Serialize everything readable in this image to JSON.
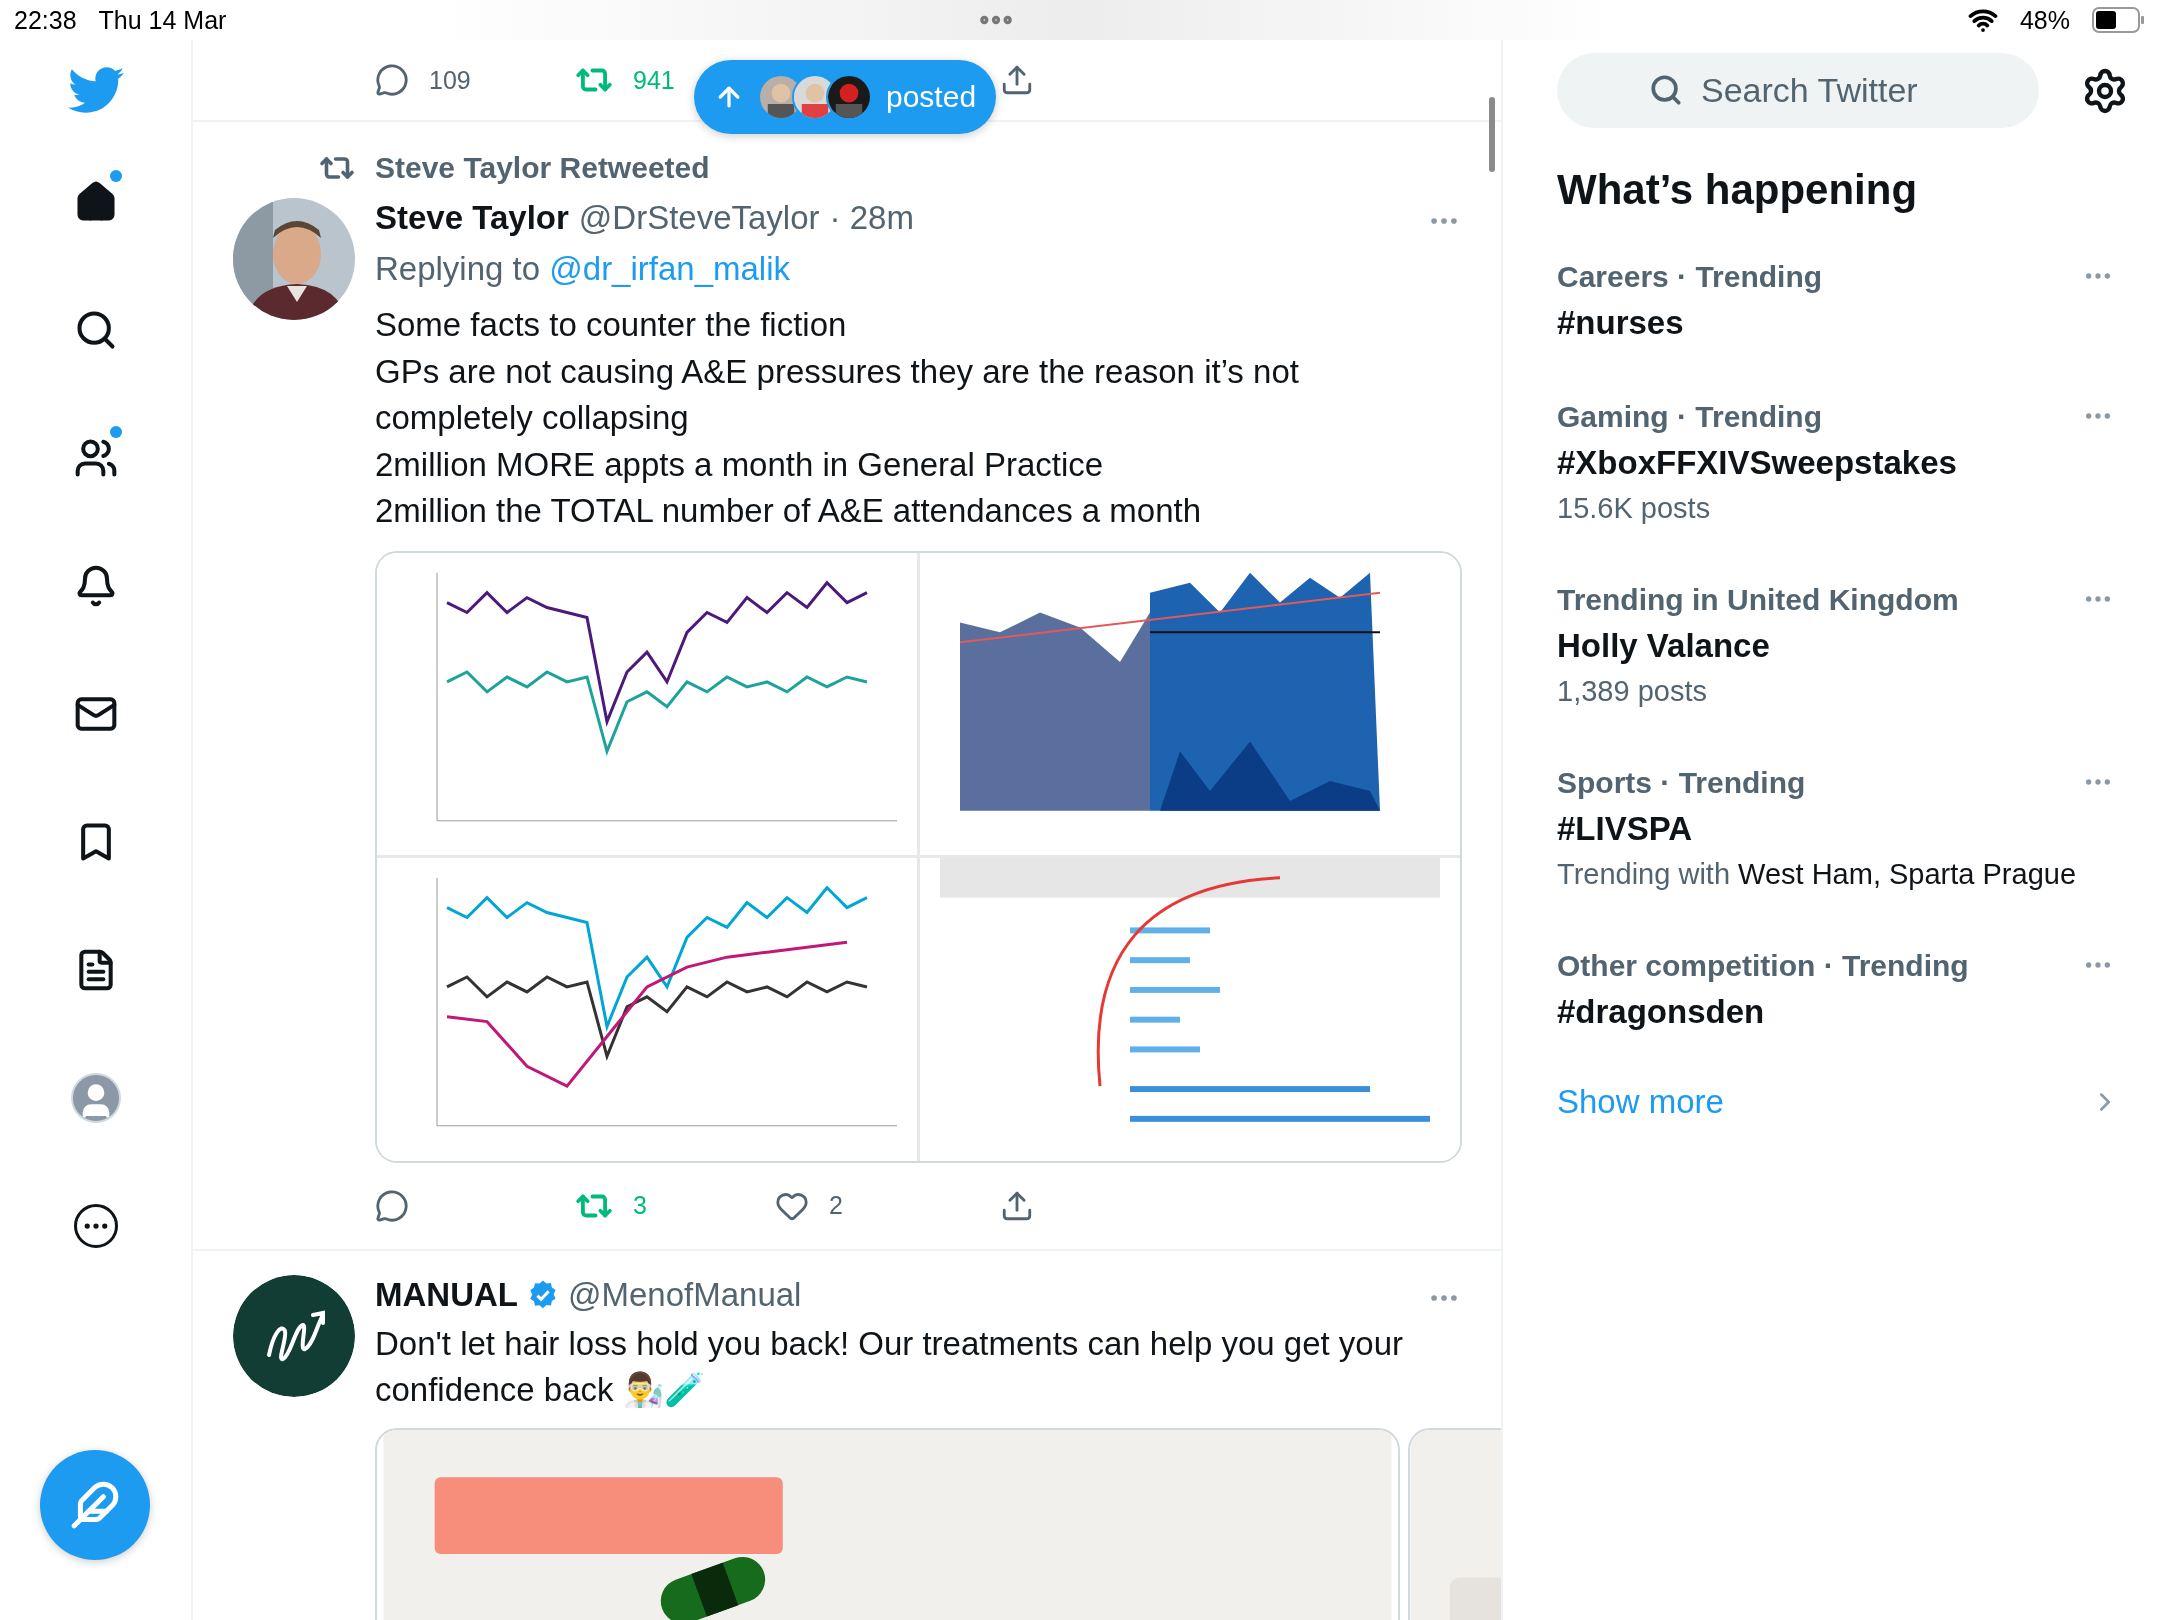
{
  "status_bar": {
    "time": "22:38",
    "date": "Thu 14 Mar",
    "battery": "48%"
  },
  "nav": [
    {
      "kind": "logo",
      "dot": false
    },
    {
      "kind": "home",
      "dot": true
    },
    {
      "kind": "search",
      "dot": false
    },
    {
      "kind": "people",
      "dot": true
    },
    {
      "kind": "bell",
      "dot": false
    },
    {
      "kind": "mail",
      "dot": false
    },
    {
      "kind": "bookmark",
      "dot": false
    },
    {
      "kind": "list",
      "dot": false
    },
    {
      "kind": "avatar",
      "dot": false
    },
    {
      "kind": "more",
      "dot": false
    }
  ],
  "previous_tweet_actions": {
    "replies": "109",
    "retweets": "941",
    "retweeted": true
  },
  "posted_pill": {
    "label": "posted"
  },
  "tweets": [
    {
      "retweeted_by": "Steve Taylor Retweeted",
      "name": "Steve Taylor",
      "verified": false,
      "handle": "@DrSteveTaylor",
      "time": "· 28m",
      "replying_prefix": "Replying to",
      "replying_handle": "@dr_irfan_malik",
      "lines": [
        "Some facts to counter the fiction",
        "GPs are not causing A&E pressures they are the reason it’s not completely collapsing",
        "2million MORE appts a month in General Practice",
        "2million the TOTAL number of A&E attendances a month"
      ],
      "media": {
        "kind": "chart-grid"
      },
      "actions": {
        "retweets": "3",
        "likes": "2",
        "retweeted": true
      }
    },
    {
      "name": "MANUAL",
      "verified": true,
      "handle": "@MenofManual",
      "lines": [
        "Don't let hair loss hold you back! Our treatments can help you get your confidence back 👨‍🔬🧪"
      ],
      "media": {
        "kind": "carousel"
      }
    }
  ],
  "search": {
    "placeholder": "Search Twitter"
  },
  "trends_title": "What’s happening",
  "trends": [
    {
      "category": "Careers · Trending",
      "title": "#nurses"
    },
    {
      "category": "Gaming · Trending",
      "title": "#XboxFFXIVSweepstakes",
      "posts": "15.6K posts"
    },
    {
      "category": "Trending in United Kingdom",
      "title": "Holly Valance",
      "posts": "1,389 posts"
    },
    {
      "category": "Sports · Trending",
      "title": "#LIVSPA",
      "context_prefix": "Trending with",
      "context_names": "West Ham, Sparta Prague"
    },
    {
      "category": "Other competition · Trending",
      "title": "#dragonsden"
    }
  ],
  "show_more": "Show more"
}
